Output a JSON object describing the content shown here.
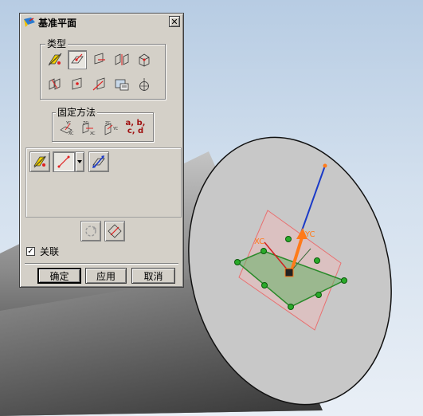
{
  "dialog": {
    "title": "基准平面",
    "close_glyph": "✕",
    "type_group_label": "类型",
    "method_group_label": "固定方法",
    "abcd_label_1": "a, b,",
    "abcd_label_2": "c, d",
    "associative_label": "关联",
    "associative_checked": true,
    "check_glyph": "✓",
    "ok_label": "确定",
    "apply_label": "应用",
    "cancel_label": "取消"
  },
  "viewport": {
    "xc_label": "XC",
    "yc_label": "YC",
    "colors": {
      "background": "#c8d8ea",
      "disc_face": "#c8c8c8",
      "cylinder_shade": "#5a5a5a",
      "plane_outline": "#2a8a2a",
      "handle_point": "#2aaa2a",
      "axis_blue": "#1a3ac8",
      "csys_orange": "#ff7a1a",
      "preview_plane": "#e87070"
    }
  }
}
